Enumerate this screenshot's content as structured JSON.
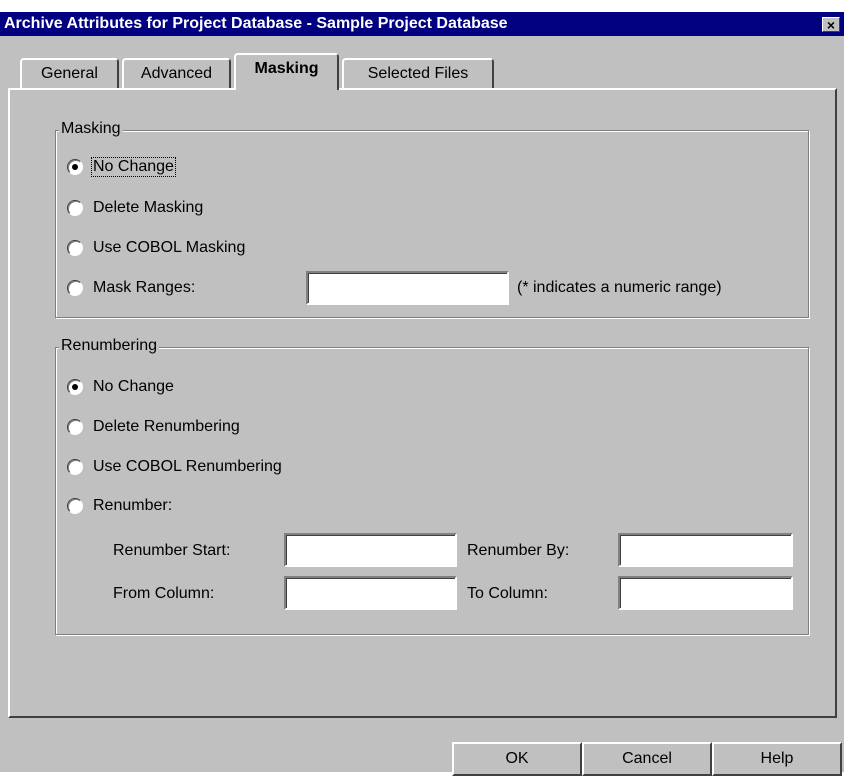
{
  "window": {
    "title": "Archive Attributes for Project Database - Sample Project Database",
    "close_glyph": "×"
  },
  "tabs": [
    {
      "label": "General",
      "active": false
    },
    {
      "label": "Advanced",
      "active": false
    },
    {
      "label": "Masking",
      "active": true
    },
    {
      "label": "Selected Files",
      "active": false
    }
  ],
  "masking": {
    "group_label": "Masking",
    "options": [
      {
        "label": "No Change",
        "selected": true,
        "focused": true
      },
      {
        "label": "Delete Masking",
        "selected": false
      },
      {
        "label": "Use COBOL Masking",
        "selected": false
      },
      {
        "label": "Mask Ranges:",
        "selected": false
      }
    ],
    "mask_ranges_value": "",
    "mask_ranges_hint": "(* indicates a numeric range)"
  },
  "renumbering": {
    "group_label": "Renumbering",
    "options": [
      {
        "label": "No Change",
        "selected": true
      },
      {
        "label": "Delete Renumbering",
        "selected": false
      },
      {
        "label": "Use COBOL Renumbering",
        "selected": false
      },
      {
        "label": "Renumber:",
        "selected": false
      }
    ],
    "fields": {
      "start_label": "Renumber Start:",
      "start_value": "",
      "by_label": "Renumber By:",
      "by_value": "",
      "from_label": "From Column:",
      "from_value": "",
      "to_label": "To Column:",
      "to_value": ""
    }
  },
  "buttons": {
    "ok": "OK",
    "cancel": "Cancel",
    "help": "Help"
  },
  "colors": {
    "titlebar": "#000080",
    "dialog_face": "#c0c0c0"
  }
}
